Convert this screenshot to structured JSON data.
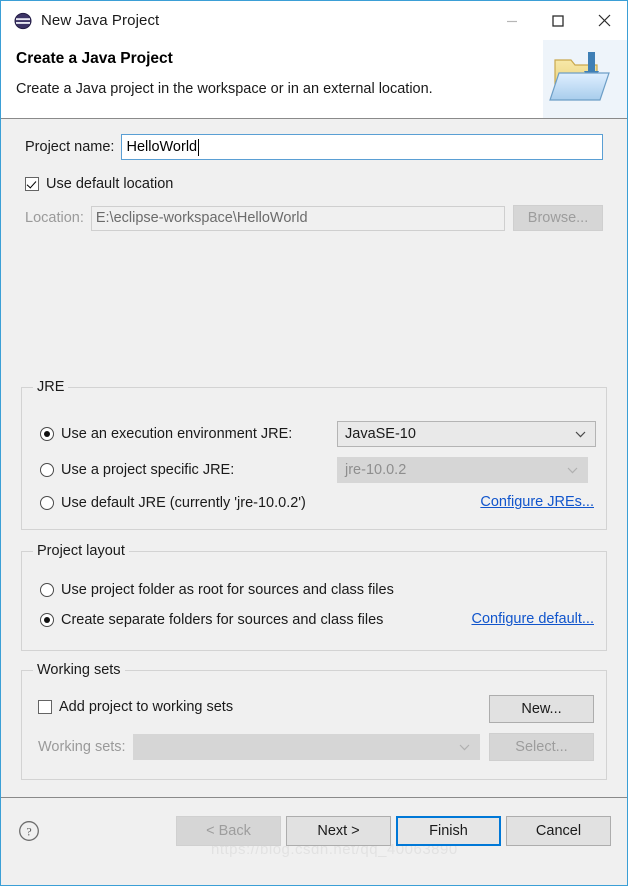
{
  "window": {
    "title": "New Java Project",
    "icon": "eclipse-sphere-icon",
    "controls": {
      "minimize": "minimize-icon",
      "maximize": "maximize-icon",
      "close": "close-icon"
    }
  },
  "banner": {
    "title": "Create a Java Project",
    "description": "Create a Java project in the workspace or in an external location.",
    "icon": "java-project-folder-icon"
  },
  "project": {
    "name_label": "Project name:",
    "name_value": "HelloWorld",
    "use_default_location_label": "Use default location",
    "use_default_location_checked": true,
    "location_label": "Location:",
    "location_value": "E:\\eclipse-workspace\\HelloWorld",
    "browse_label": "Browse..."
  },
  "jre": {
    "group_title": "JRE",
    "options": [
      {
        "label": "Use an execution environment JRE:",
        "selected": true
      },
      {
        "label": "Use a project specific JRE:",
        "selected": false
      },
      {
        "label": "Use default JRE (currently 'jre-10.0.2')",
        "selected": false
      }
    ],
    "execution_environment_value": "JavaSE-10",
    "project_specific_value": "jre-10.0.2",
    "configure_link": "Configure JREs..."
  },
  "layout": {
    "group_title": "Project layout",
    "options": [
      {
        "label": "Use project folder as root for sources and class files",
        "selected": false
      },
      {
        "label": "Create separate folders for sources and class files",
        "selected": true
      }
    ],
    "configure_link": "Configure default..."
  },
  "working_sets": {
    "group_title": "Working sets",
    "add_label": "Add project to working sets",
    "add_checked": false,
    "new_button": "New...",
    "sets_label": "Working sets:",
    "sets_value": "",
    "select_button": "Select..."
  },
  "footer": {
    "help_icon": "help-question-icon",
    "back": "< Back",
    "next": "Next >",
    "finish": "Finish",
    "cancel": "Cancel",
    "watermark": "https://blog.csdn.net/qq_40063890"
  },
  "colors": {
    "accent": "#0078d7",
    "link": "#1155cc",
    "window_border": "#3b9fd6",
    "body_bg": "#f0f0f0"
  }
}
